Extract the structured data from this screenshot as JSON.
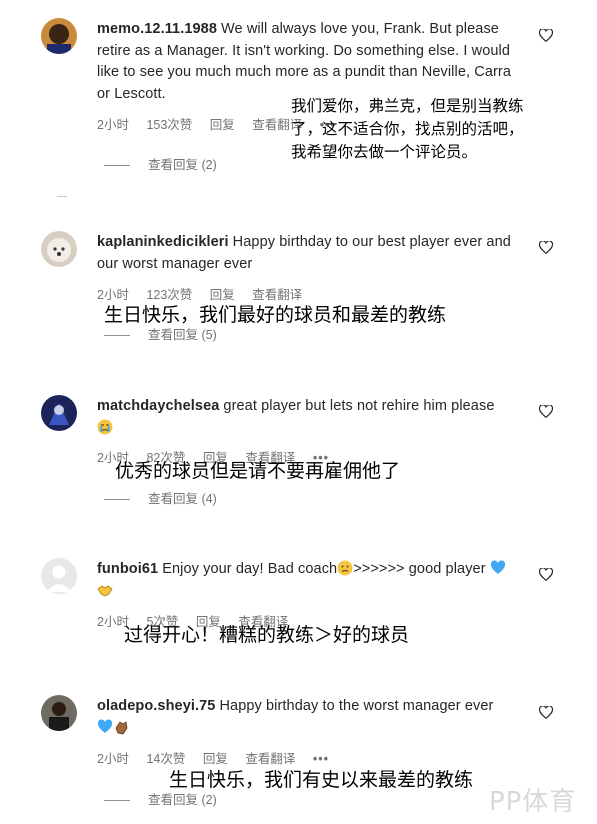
{
  "comments": [
    {
      "username": "memo.12.11.1988",
      "text": "We will always love you, Frank. But please retire as a Manager. It isn't working. Do something else. I would like to see you much much more as a pundit than Neville, Carra or Lescott.",
      "time": "2小时",
      "likes": "153次赞",
      "reply": "回复",
      "translate": "查看翻译",
      "more": "•••",
      "view_replies": "查看回复 (2)",
      "overlay_lines": [
        "我们爱你，弗兰克，但是别当教练",
        "了，这不适合你，找点别的活吧，",
        "我希望你去做一个评论员。"
      ]
    },
    {
      "username": "kaplaninkedicikleri",
      "text": "Happy birthday to our best player ever and our worst manager ever",
      "time": "2小时",
      "likes": "123次赞",
      "reply": "回复",
      "translate": "查看翻译",
      "view_replies": "查看回复 (5)",
      "overlay": "生日快乐，我们最好的球员和最差的教练"
    },
    {
      "username": "matchdaychelsea",
      "text": "great player but lets not rehire him please",
      "emoji": "crying-face",
      "time": "2小时",
      "likes": "82次赞",
      "reply": "回复",
      "translate": "查看翻译",
      "more": "•••",
      "view_replies": "查看回复 (4)",
      "overlay": "优秀的球员但是请不要再雇佣他了"
    },
    {
      "username": "funboi61",
      "text_before": "Enjoy your day! Bad coach",
      "text_after": ">>>>>> good player",
      "time": "2小时",
      "likes": "5次赞",
      "reply": "回复",
      "translate": "查看翻译",
      "overlay": "过得开心！糟糕的教练＞好的球员"
    },
    {
      "username": "oladepo.sheyi.75",
      "text": "Happy birthday to the worst manager ever",
      "time": "2小时",
      "likes": "14次赞",
      "reply": "回复",
      "translate": "查看翻译",
      "more": "•••",
      "view_replies": "查看回复 (2)",
      "overlay": "生日快乐，我们有史以来最差的教练"
    }
  ],
  "watermark": "PP体育",
  "colors": {
    "text": "#262626",
    "meta": "#737373",
    "blue_heart": "#3fa9f5",
    "yellow": "#f5c542"
  }
}
